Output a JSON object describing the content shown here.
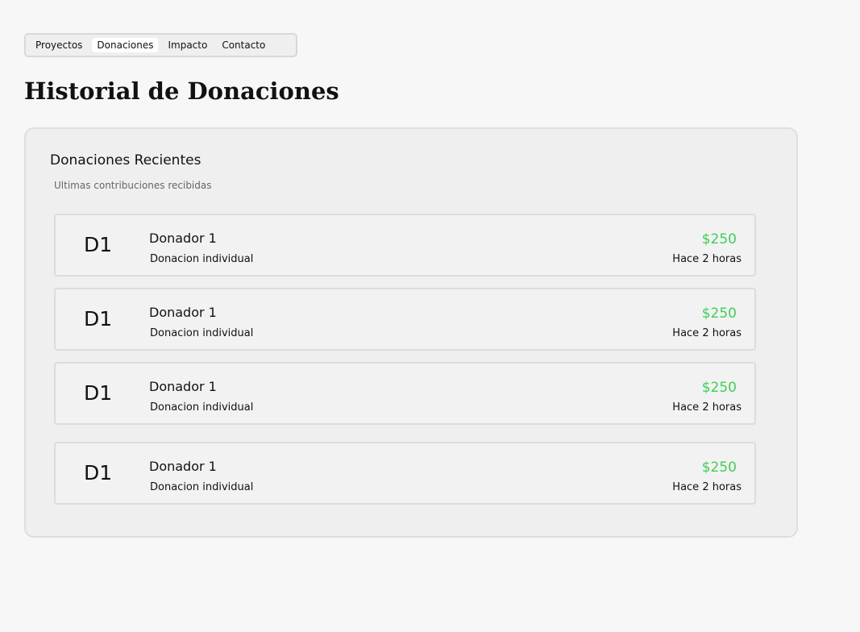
{
  "colors": {
    "amount": "#3ecf56",
    "background": "#f7f7f7",
    "card_background": "#efefef"
  },
  "nav": {
    "tabs": [
      {
        "label": "Proyectos"
      },
      {
        "label": "Donaciones"
      },
      {
        "label": "Impacto"
      },
      {
        "label": "Contacto"
      }
    ],
    "active": "Donaciones"
  },
  "page": {
    "title": "Historial de Donaciones"
  },
  "card": {
    "title": "Donaciones Recientes",
    "subtitle": "Ultimas contribuciones recibidas",
    "donations": [
      {
        "avatar": "D1",
        "name": "Donador 1",
        "type": "Donacion individual",
        "amount": "$250",
        "time": "Hace 2 horas"
      },
      {
        "avatar": "D1",
        "name": "Donador 1",
        "type": "Donacion individual",
        "amount": "$250",
        "time": "Hace 2 horas"
      },
      {
        "avatar": "D1",
        "name": "Donador 1",
        "type": "Donacion individual",
        "amount": "$250",
        "time": "Hace 2 horas"
      },
      {
        "avatar": "D1",
        "name": "Donador 1",
        "type": "Donacion individual",
        "amount": "$250",
        "time": "Hace 2 horas"
      }
    ]
  }
}
